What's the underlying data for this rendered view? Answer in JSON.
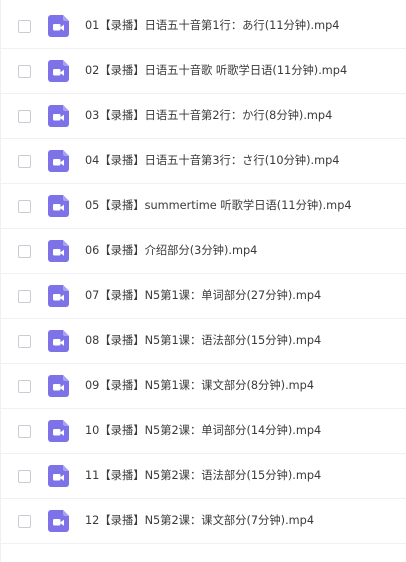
{
  "theme": {
    "icon_color": "#7d72e8",
    "icon_fold_color": "#aaa3f2"
  },
  "files": [
    {
      "name": "01【录播】日语五十音第1行：あ行(11分钟).mp4",
      "icon": "video-file-icon"
    },
    {
      "name": "02【录播】日语五十音歌 听歌学日语(11分钟).mp4",
      "icon": "video-file-icon"
    },
    {
      "name": "03【录播】日语五十音第2行：か行(8分钟).mp4",
      "icon": "video-file-icon"
    },
    {
      "name": "04【录播】日语五十音第3行：さ行(10分钟).mp4",
      "icon": "video-file-icon"
    },
    {
      "name": "05【录播】summertime 听歌学日语(11分钟).mp4",
      "icon": "video-file-icon"
    },
    {
      "name": "06【录播】介绍部分(3分钟).mp4",
      "icon": "video-file-icon"
    },
    {
      "name": "07【录播】N5第1课：单词部分(27分钟).mp4",
      "icon": "video-file-icon"
    },
    {
      "name": "08【录播】N5第1课：语法部分(15分钟).mp4",
      "icon": "video-file-icon"
    },
    {
      "name": "09【录播】N5第1课：课文部分(8分钟).mp4",
      "icon": "video-file-icon"
    },
    {
      "name": "10【录播】N5第2课：单词部分(14分钟).mp4",
      "icon": "video-file-icon"
    },
    {
      "name": "11【录播】N5第2课：语法部分(15分钟).mp4",
      "icon": "video-file-icon"
    },
    {
      "name": "12【录播】N5第2课：课文部分(7分钟).mp4",
      "icon": "video-file-icon"
    }
  ]
}
